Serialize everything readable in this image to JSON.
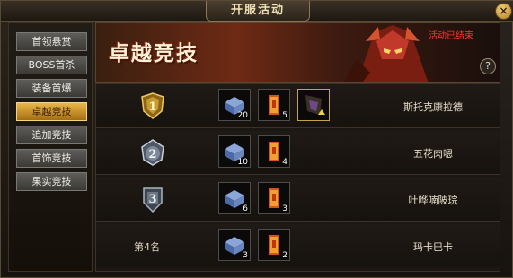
{
  "window": {
    "title": "开服活动",
    "close_label": "×"
  },
  "sidebar": {
    "items": [
      {
        "label": "首领悬赏",
        "active": false
      },
      {
        "label": "BOSS首杀",
        "active": false
      },
      {
        "label": "装备首爆",
        "active": false
      },
      {
        "label": "卓越竞技",
        "active": true
      },
      {
        "label": "追加竞技",
        "active": false
      },
      {
        "label": "首饰竞技",
        "active": false
      },
      {
        "label": "果实竞技",
        "active": false
      }
    ]
  },
  "banner": {
    "title": "卓越竞技",
    "status": "活动已结束",
    "help": "?"
  },
  "rankings": [
    {
      "rank": "1",
      "rank_label": "",
      "items": [
        {
          "icon": "crate-icon",
          "count": "20"
        },
        {
          "icon": "scroll-icon",
          "count": "5"
        },
        {
          "icon": "wings-icon",
          "count": ""
        }
      ],
      "player": "斯托克康拉德"
    },
    {
      "rank": "2",
      "rank_label": "",
      "items": [
        {
          "icon": "crate-icon",
          "count": "10"
        },
        {
          "icon": "scroll-icon",
          "count": "4"
        }
      ],
      "player": "五花肉嗯"
    },
    {
      "rank": "3",
      "rank_label": "",
      "items": [
        {
          "icon": "crate-icon",
          "count": "6"
        },
        {
          "icon": "scroll-icon",
          "count": "3"
        }
      ],
      "player": "吐哗喃陂琓"
    },
    {
      "rank": "",
      "rank_label": "第4名",
      "items": [
        {
          "icon": "crate-icon",
          "count": "3"
        },
        {
          "icon": "scroll-icon",
          "count": "2"
        }
      ],
      "player": "玛卡巴卡"
    }
  ],
  "colors": {
    "accent": "#e8b848",
    "status": "#ff3636",
    "gold": "#c9a04a"
  }
}
